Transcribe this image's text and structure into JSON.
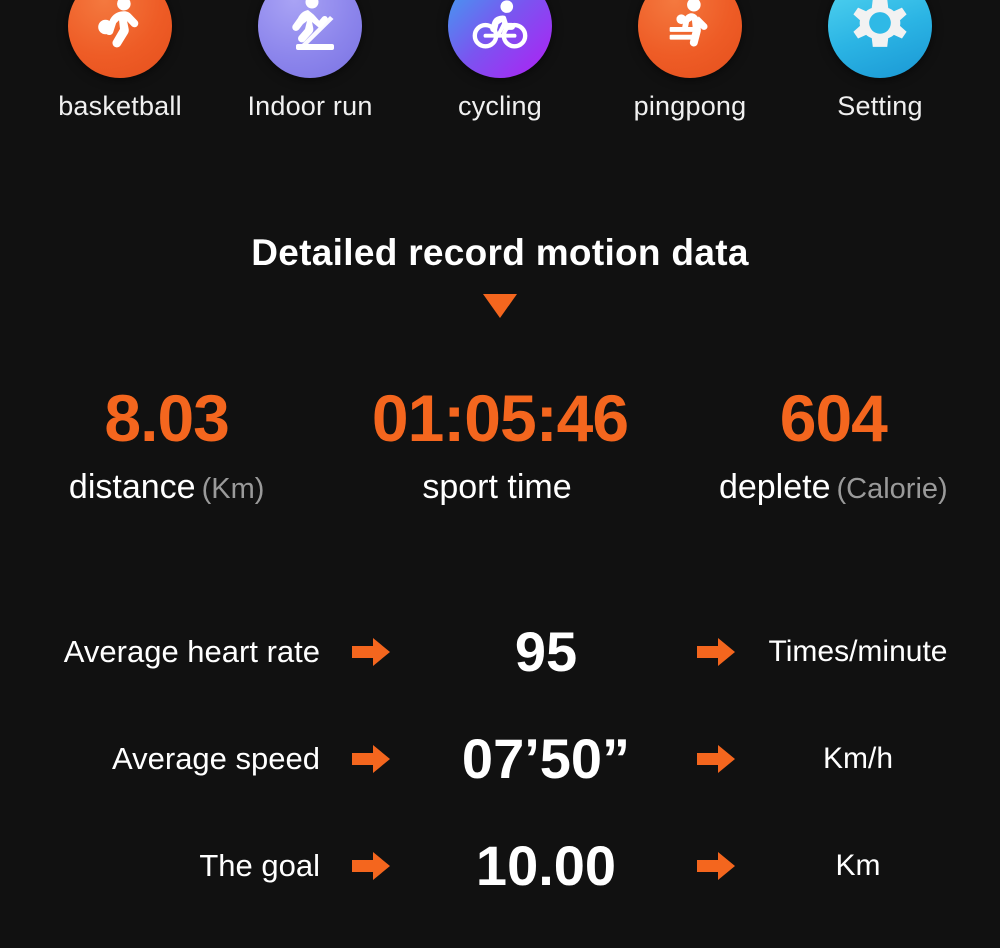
{
  "theme": {
    "background": "#111111",
    "accent_orange": "#f4661e",
    "text_white": "#ffffff",
    "text_gray": "#9a9a9a"
  },
  "sport_modes": [
    {
      "label": "basketball",
      "icon": "basketball-player-icon",
      "badge_from": "#f4seven",
      "badge_color_start": "#f4713a",
      "badge_color_end": "#ea5420"
    },
    {
      "label": "Indoor run",
      "icon": "treadmill-runner-icon",
      "badge_color_start": "#9b95f0",
      "badge_color_end": "#7a72e3"
    },
    {
      "label": "cycling",
      "icon": "cyclist-icon",
      "badge_color_start": "#3aa6f0",
      "badge_color_end": "#b11ef4"
    },
    {
      "label": "pingpong",
      "icon": "table-tennis-player-icon",
      "badge_color_start": "#f4713a",
      "badge_color_end": "#e8501c"
    },
    {
      "label": "Setting",
      "icon": "gear-icon",
      "badge_color_start": "#4ad2f0",
      "badge_color_end": "#1a9ad6"
    }
  ],
  "header": {
    "title": "Detailed record motion data",
    "caret": "down-triangle-icon"
  },
  "primary_stats": [
    {
      "value": "8.03",
      "caption": "distance",
      "unit": "(Km)"
    },
    {
      "value": "01:05:46",
      "caption": "sport time",
      "unit": ""
    },
    {
      "value": "604",
      "caption": "deplete",
      "unit": "(Calorie)"
    }
  ],
  "metrics": [
    {
      "label": "Average heart rate",
      "value": "95",
      "unit": "Times/minute"
    },
    {
      "label": "Average speed",
      "value": "07’50”",
      "unit": "Km/h"
    },
    {
      "label": "The goal",
      "value": "10.00",
      "unit": "Km"
    }
  ]
}
